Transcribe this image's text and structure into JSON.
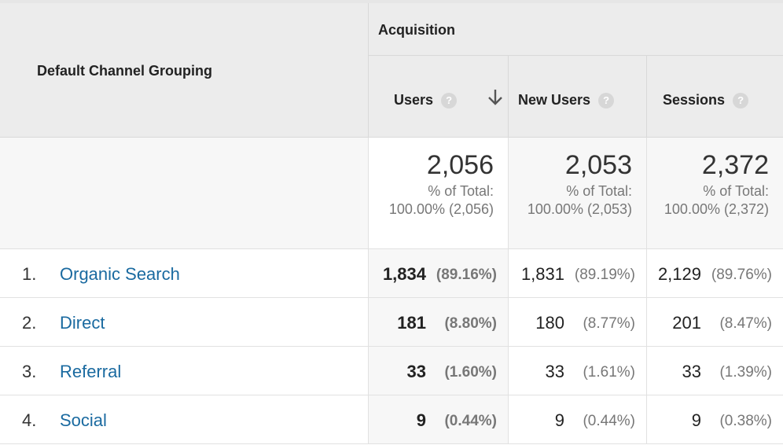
{
  "header": {
    "dimension": "Default Channel Grouping",
    "group": "Acquisition",
    "columns": [
      {
        "label": "Users",
        "help": "?",
        "sorted": true
      },
      {
        "label": "New Users",
        "help": "?"
      },
      {
        "label": "Sessions",
        "help": "?"
      }
    ]
  },
  "totals": [
    {
      "value": "2,056",
      "label": "% of Total:",
      "pct": "100.00% (2,056)"
    },
    {
      "value": "2,053",
      "label": "% of Total:",
      "pct": "100.00% (2,053)"
    },
    {
      "value": "2,372",
      "label": "% of Total:",
      "pct": "100.00% (2,372)"
    }
  ],
  "rows": [
    {
      "rank": "1.",
      "channel": "Organic Search",
      "users": "1,834",
      "users_pct": "(89.16%)",
      "new_users": "1,831",
      "new_users_pct": "(89.19%)",
      "sessions": "2,129",
      "sessions_pct": "(89.76%)"
    },
    {
      "rank": "2.",
      "channel": "Direct",
      "users": "181",
      "users_pct": "(8.80%)",
      "new_users": "180",
      "new_users_pct": "(8.77%)",
      "sessions": "201",
      "sessions_pct": "(8.47%)"
    },
    {
      "rank": "3.",
      "channel": "Referral",
      "users": "33",
      "users_pct": "(1.60%)",
      "new_users": "33",
      "new_users_pct": "(1.61%)",
      "sessions": "33",
      "sessions_pct": "(1.39%)"
    },
    {
      "rank": "4.",
      "channel": "Social",
      "users": "9",
      "users_pct": "(0.44%)",
      "new_users": "9",
      "new_users_pct": "(0.44%)",
      "sessions": "9",
      "sessions_pct": "(0.38%)"
    }
  ],
  "colors": {
    "link": "#1a6aa0",
    "header_bg": "#ececec",
    "help_bg": "#d7d7d7"
  }
}
